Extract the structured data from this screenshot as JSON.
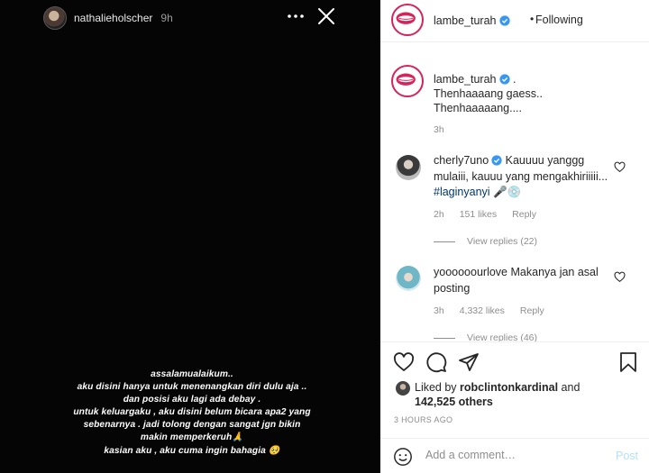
{
  "story": {
    "username": "nathalieholscher",
    "time": "9h",
    "caption_lines": [
      "assalamualaikum..",
      "aku disini hanya untuk menenangkan diri dulu aja ..",
      "dan posisi aku lagi ada debay .",
      "untuk keluargaku , aku disini belum bicara apa2 yang",
      "sebenarnya . jadi tolong dengan sangat jgn bikin",
      "makin memperkeruh🙏",
      "kasian aku , aku cuma ingin bahagia 🥺"
    ]
  },
  "post": {
    "header": {
      "username": "lambe_turah",
      "separator": "•",
      "follow_label": "Following"
    },
    "caption": {
      "username": "lambe_turah",
      "text_line1": " .",
      "text_line2": "Thenhaaaang gaess..",
      "text_line3": "Thenhaaaaang....",
      "time": "3h"
    },
    "comments": [
      {
        "username": "cherly7uno",
        "text": "Kauuuu yanggg mulaiii, kauuu yang mengakhiriiiii... ",
        "hashtag": "#laginyanyi",
        "tail": " 🎤💿",
        "time": "2h",
        "likes": "151 likes",
        "reply_label": "Reply",
        "view_replies": "View replies (22)"
      },
      {
        "username": "yoooooourlove",
        "text": "Makanya jan asal posting",
        "time": "3h",
        "likes": "4,332 likes",
        "reply_label": "Reply",
        "view_replies": "View replies (46)"
      }
    ],
    "likes": {
      "prefix": "Liked by ",
      "user": "robclintonkardinal",
      "and": " and",
      "count": "142,525 others"
    },
    "posted_time": "3 HOURS AGO",
    "add_comment": {
      "placeholder": "Add a comment…",
      "post_label": "Post"
    }
  },
  "colors": {
    "brand": "#d6245a",
    "verified": "#3897f0",
    "link": "#00376b",
    "muted": "#8e8e8e",
    "post_disabled": "#b2dffc"
  }
}
